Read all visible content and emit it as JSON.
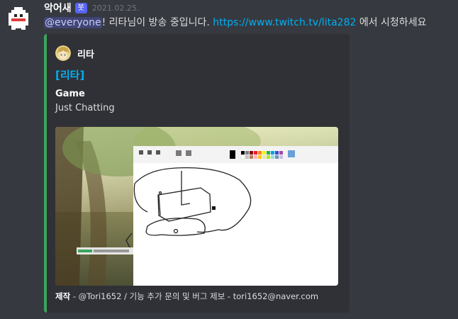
{
  "message": {
    "username": "악어새",
    "bot_tag": "봇",
    "timestamp": "2021.02.25.",
    "mention": "@everyone",
    "text_before_link": "! 리타님이 방송 중입니다. ",
    "link": "https://www.twitch.tv/lita282",
    "text_after_link": " 에서 시청하세요"
  },
  "embed": {
    "accent_color": "#3ba55c",
    "author_name": "리타",
    "title": "[리타]",
    "field_name": "Game",
    "field_value": "Just Chatting",
    "footer_label": "제작",
    "footer_text": " - @Tori1652 / 기능 추가 문의 및 버그 제보 - tori1652@naver.com"
  }
}
